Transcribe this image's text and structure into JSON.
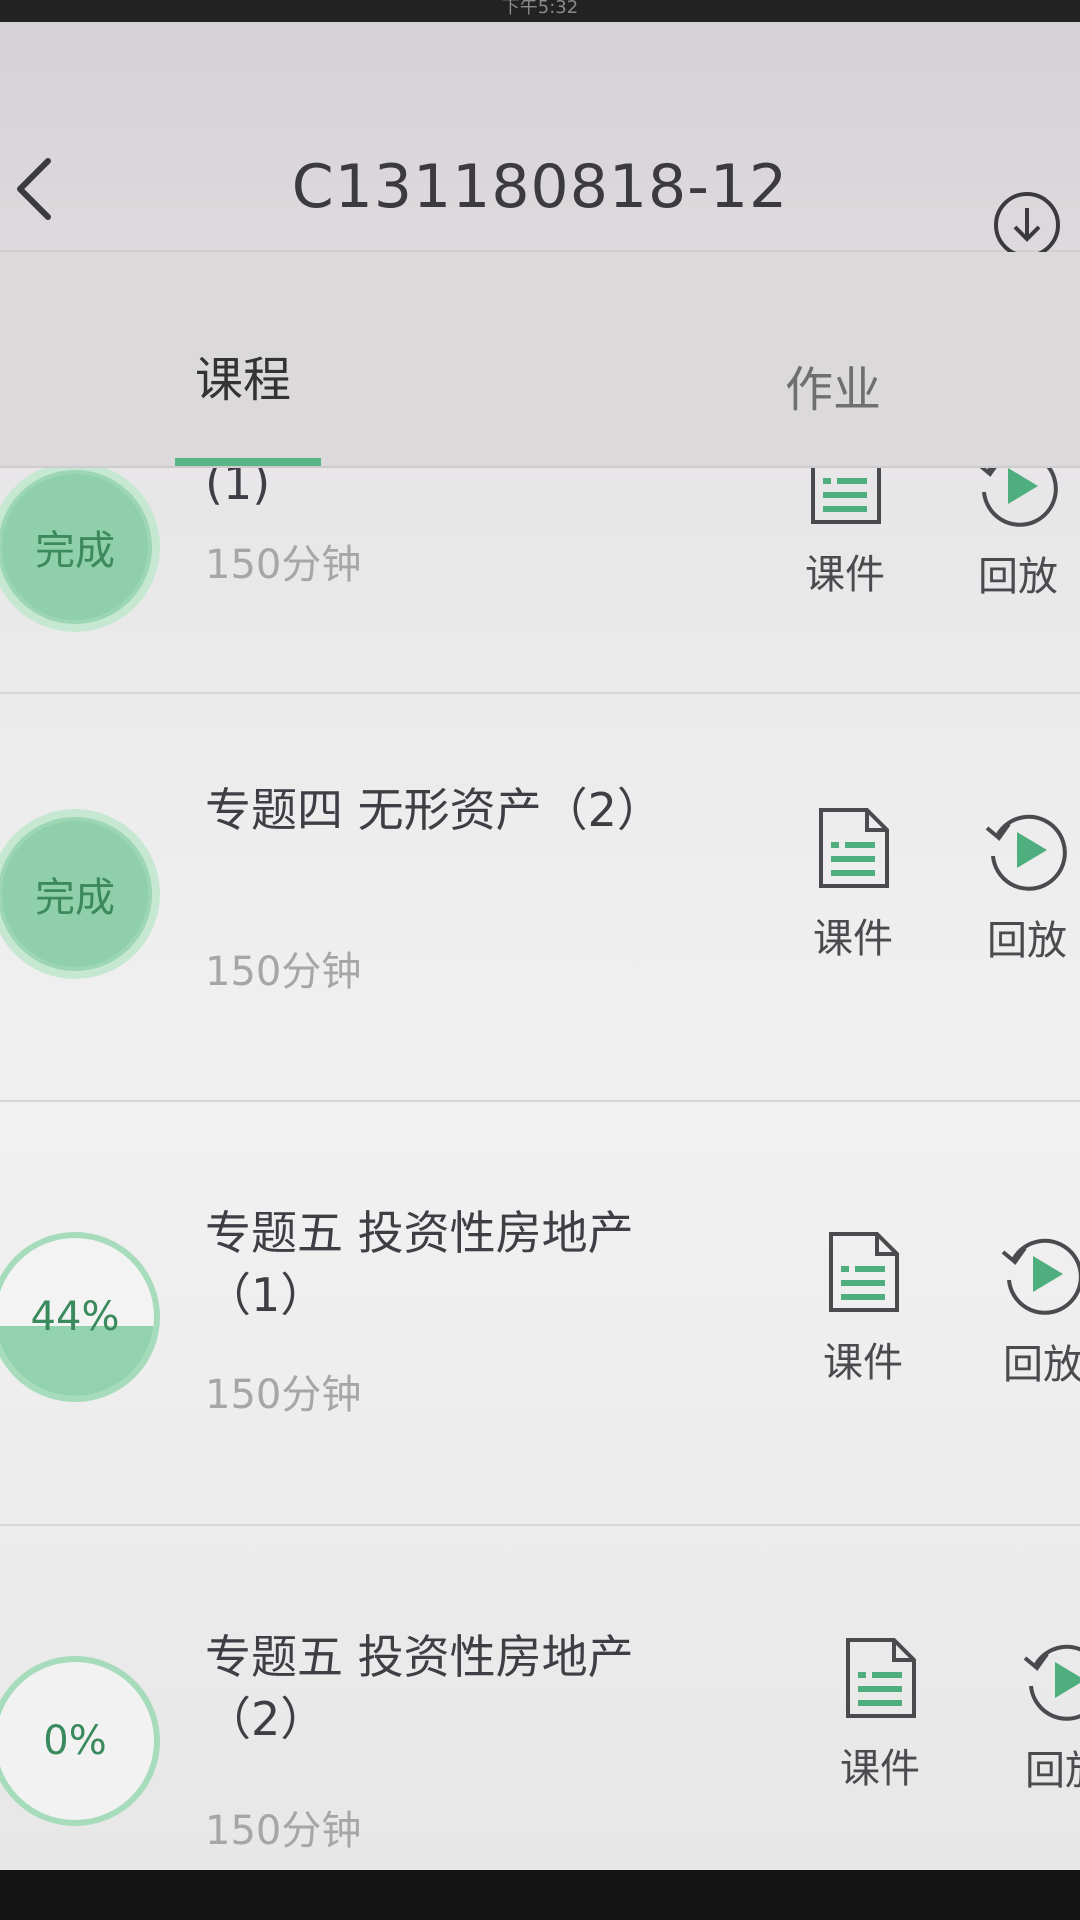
{
  "status_bar": {
    "time": "下午5:32"
  },
  "header": {
    "title": "C131180818-12"
  },
  "tabs": [
    {
      "label": "课程",
      "active": true
    },
    {
      "label": "作业",
      "active": false
    }
  ],
  "colors": {
    "accent": "#59b486",
    "complete_fill": "#8fd0aa",
    "text": "#3e3e44",
    "subtext": "#a6a6a6"
  },
  "lessons": [
    {
      "status": "完成",
      "title": "(1)",
      "duration": "150分钟",
      "courseware": "课件",
      "replay": "回放"
    },
    {
      "status": "完成",
      "title": "专题四 无形资产（2）",
      "duration": "150分钟",
      "courseware": "课件",
      "replay": "回放"
    },
    {
      "status": "44%",
      "progress": 0.44,
      "title": "专题五 投资性房地产（1）",
      "duration": "150分钟",
      "courseware": "课件",
      "replay": "回放"
    },
    {
      "status": "0%",
      "progress": 0,
      "title": "专题五 投资性房地产（2）",
      "duration": "150分钟",
      "courseware": "课件",
      "replay": "回放"
    }
  ],
  "icons": {
    "back": "chevron-left-icon",
    "download": "download-circle-icon",
    "courseware": "document-icon",
    "replay": "replay-icon"
  }
}
